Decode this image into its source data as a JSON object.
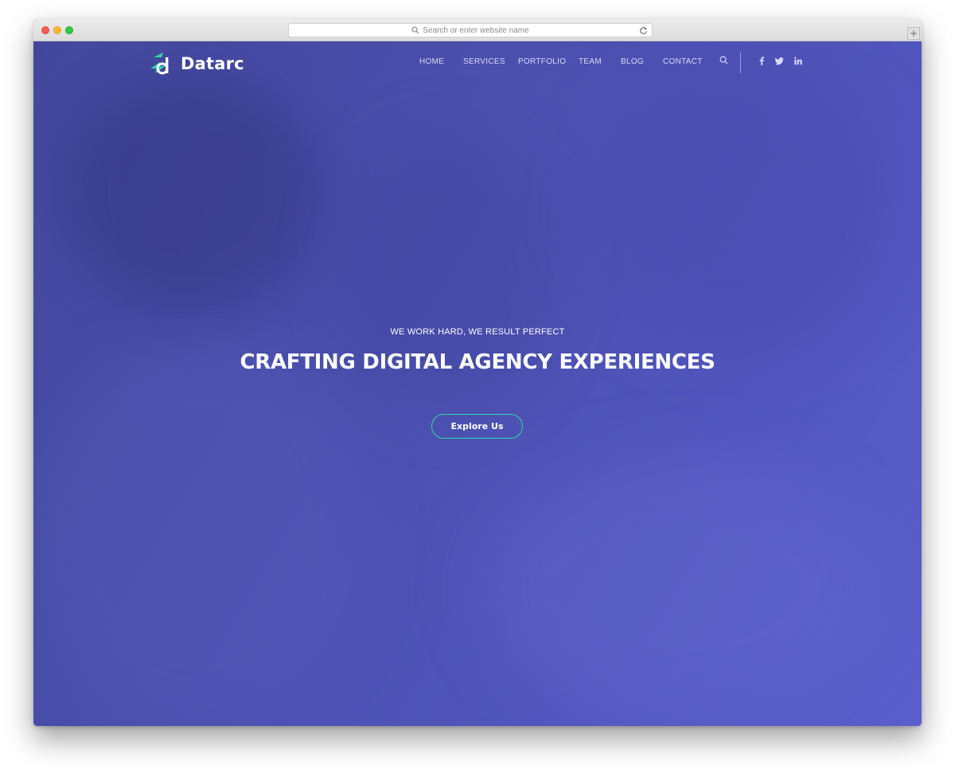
{
  "browser": {
    "address_placeholder": "Search or enter website name"
  },
  "site": {
    "brand": "Datarc",
    "accent_color": "#2fd8a4",
    "overlay_color": "#4c4faf",
    "nav": [
      {
        "label": "HOME"
      },
      {
        "label": "SERVICES"
      },
      {
        "label": "PORTFOLIO"
      },
      {
        "label": "TEAM"
      },
      {
        "label": "BLOG"
      },
      {
        "label": "CONTACT"
      }
    ],
    "social": [
      "facebook-icon",
      "twitter-icon",
      "linkedin-icon"
    ]
  },
  "hero": {
    "subtitle": "WE WORK HARD, WE RESULT PERFECT",
    "title": "CRAFTING DIGITAL AGENCY EXPERIENCES",
    "cta_label": "Explore Us"
  }
}
